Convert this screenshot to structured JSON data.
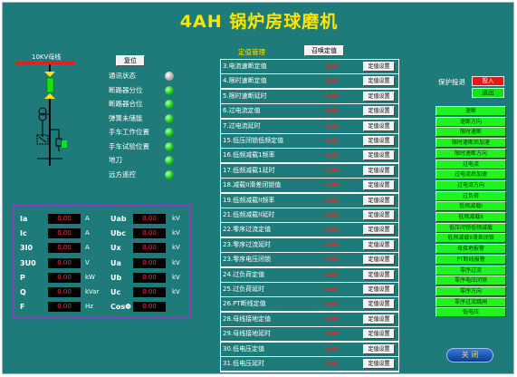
{
  "title": "4AH  锅炉房球磨机",
  "bus_label": "10KV母线",
  "reset_button": "复位",
  "status": [
    {
      "label": "通讯状态",
      "state": "off"
    },
    {
      "label": "断路器分位",
      "state": "on"
    },
    {
      "label": "断路器合位",
      "state": "on"
    },
    {
      "label": "弹簧未储能",
      "state": "on"
    },
    {
      "label": "手车工作位置",
      "state": "on"
    },
    {
      "label": "手车试验位置",
      "state": "on"
    },
    {
      "label": "地刀",
      "state": "on"
    },
    {
      "label": "远方遥控",
      "state": "on"
    }
  ],
  "measurements": {
    "left": [
      {
        "label": "Ia",
        "value": "0.00",
        "unit": "A"
      },
      {
        "label": "Ic",
        "value": "0.00",
        "unit": "A"
      },
      {
        "label": "3I0",
        "value": "0.00",
        "unit": "A"
      },
      {
        "label": "3U0",
        "value": "0.00",
        "unit": "V"
      },
      {
        "label": "P",
        "value": "0.00",
        "unit": "kW"
      },
      {
        "label": "Q",
        "value": "0.00",
        "unit": "kVar"
      },
      {
        "label": "F",
        "value": "0.00",
        "unit": "Hz"
      }
    ],
    "right": [
      {
        "label": "Uab",
        "value": "0.00",
        "unit": "kV"
      },
      {
        "label": "Ubc",
        "value": "0.00",
        "unit": "kV"
      },
      {
        "label": "Ux",
        "value": "0.00",
        "unit": "kV"
      },
      {
        "label": "Ua",
        "value": "0.00",
        "unit": "kV"
      },
      {
        "label": "Ub",
        "value": "0.00",
        "unit": "kV"
      },
      {
        "label": "Uc",
        "value": "0.00",
        "unit": "kV"
      },
      {
        "label": "CosΦ",
        "value": "0.00",
        "unit": ""
      }
    ]
  },
  "settings": {
    "header": "定值管理",
    "recall_button": "召唤定值",
    "set_button": "定值设置",
    "rows": [
      {
        "name": "3.电流速断定值",
        "value": "0.00"
      },
      {
        "name": "4.限时速断定值",
        "value": "0.00"
      },
      {
        "name": "5.限时速断延时",
        "value": "0.00"
      },
      {
        "name": "6.过电流定值",
        "value": "0.00"
      },
      {
        "name": "7.过电流延时",
        "value": "0.00"
      },
      {
        "name": "15.低压闭锁低频定值",
        "value": "0.00"
      },
      {
        "name": "16.低频减载1频率",
        "value": "0.00"
      },
      {
        "name": "17.低频减载1延时",
        "value": "0.00"
      },
      {
        "name": "18.减载II滑差闭锁值",
        "value": "0.00"
      },
      {
        "name": "19.低频减载II频率",
        "value": "0.00"
      },
      {
        "name": "21.低频减载II延时",
        "value": "0.00"
      },
      {
        "name": "22.零序过流定值",
        "value": "0.00"
      },
      {
        "name": "23.零序过流延时",
        "value": "0.00"
      },
      {
        "name": "23.零序电压闭锁",
        "value": "0.00"
      },
      {
        "name": "24.过负荷定值",
        "value": "0.00"
      },
      {
        "name": "25.过负荷延时",
        "value": "0.00"
      },
      {
        "name": "26.PT断线定值",
        "value": "0.00"
      },
      {
        "name": "28.母线接地定值",
        "value": "0.00"
      },
      {
        "name": "29.母线接地延时",
        "value": "0.00"
      },
      {
        "name": "30.低电压定值",
        "value": "0.00"
      },
      {
        "name": "31.低电压延时",
        "value": "0.00"
      }
    ]
  },
  "protection": {
    "label": "保护投退",
    "on_label": "投入",
    "off_label": "退出"
  },
  "indicators": [
    "速断",
    "速断方向",
    "限时速断",
    "限时速断后加速",
    "限时速断方向",
    "过电流",
    "过电流后加速",
    "过电流方向",
    "过负荷",
    "低频减载I",
    "低频减载II",
    "低压闭锁低频减载",
    "低频减载II滑差闭锁",
    "母接地报警",
    "PT断线报警",
    "零序过流",
    "零序电压闭锁",
    "零序方向",
    "零序过流跳闸",
    "低电压"
  ],
  "close_button": "关 闭",
  "colors": {
    "background": "#1f7b79",
    "title": "#ffe400",
    "value": "#ff2020",
    "indicator": "#1ef51e",
    "frame": "#8a3dbc"
  }
}
